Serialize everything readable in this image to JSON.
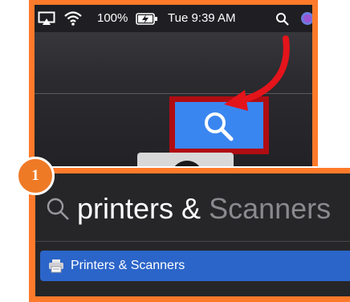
{
  "menubar": {
    "battery_percent": "100%",
    "clock": "Tue 9:39 AM",
    "icons": [
      "screen-share-icon",
      "wifi-icon",
      "battery-charging-icon",
      "spotlight-icon",
      "siri-icon"
    ]
  },
  "callout": {
    "highlight_color": "#b00d12",
    "arrow_color": "#e4141b",
    "frame_color": "#ff7a2a"
  },
  "step": {
    "number": "1",
    "badge_color": "#ef7a26"
  },
  "spotlight": {
    "query_typed": "printers &",
    "query_completion": " Scanners",
    "results": [
      {
        "label": "Printers & Scanners",
        "icon": "printer-icon",
        "selected": true
      }
    ],
    "selection_color": "#2b65c9"
  }
}
